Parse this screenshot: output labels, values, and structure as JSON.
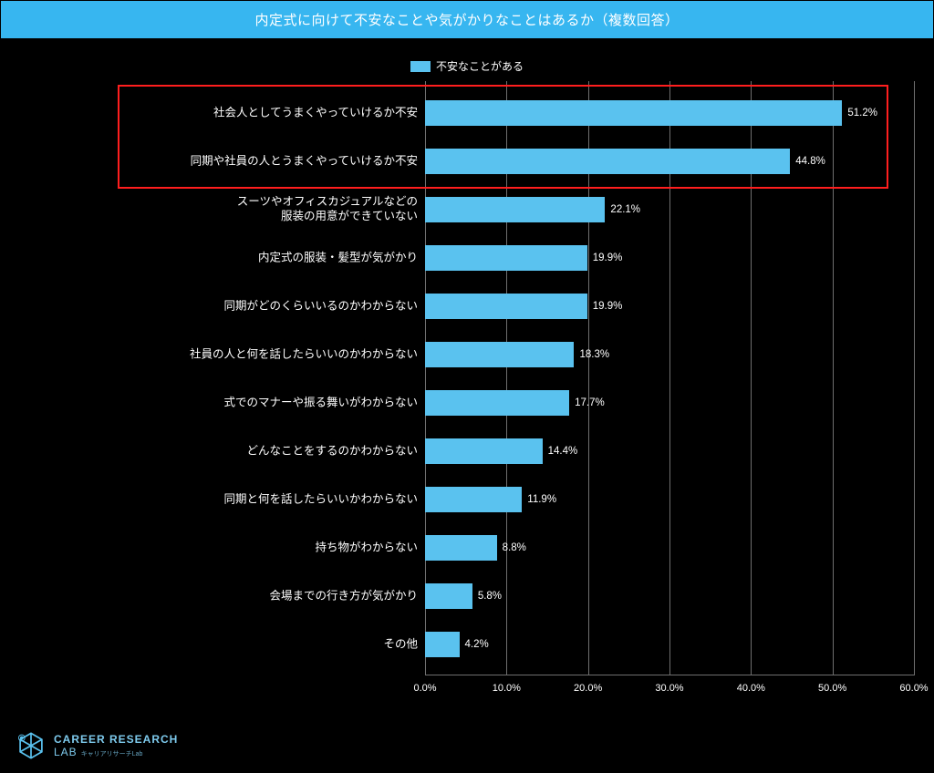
{
  "title": "内定式に向けて不安なことや気がかりなことはあるか（複数回答）",
  "legend_label": "不安なことがある",
  "xaxis": {
    "min": 0,
    "max": 60,
    "ticks": [
      0,
      10,
      20,
      30,
      40,
      50,
      60
    ],
    "unit": "%"
  },
  "logo": {
    "line1": "CAREER RESEARCH",
    "line2": "LAB",
    "sub": "キャリアリサーチLab"
  },
  "highlight_rows": [
    0,
    1
  ],
  "chart_data": {
    "type": "bar",
    "orientation": "horizontal",
    "title": "内定式に向けて不安なことや気がかりなことはあるか（複数回答）",
    "xlabel": "",
    "ylabel": "",
    "xlim": [
      0,
      60
    ],
    "unit": "%",
    "categories": [
      "社会人としてうまくやっていけるか不安",
      "同期や社員の人とうまくやっていけるか不安",
      "スーツやオフィスカジュアルなどの\n服装の用意ができていない",
      "内定式の服装・髪型が気がかり",
      "同期がどのくらいいるのかわからない",
      "社員の人と何を話したらいいのかわからない",
      "式でのマナーや振る舞いがわからない",
      "どんなことをするのかわからない",
      "同期と何を話したらいいかわからない",
      "持ち物がわからない",
      "会場までの行き方が気がかり",
      "その他"
    ],
    "values": [
      51.2,
      44.8,
      22.1,
      19.9,
      19.9,
      18.3,
      17.7,
      14.4,
      11.9,
      8.8,
      5.8,
      4.2
    ],
    "series_name": "不安なことがある"
  }
}
